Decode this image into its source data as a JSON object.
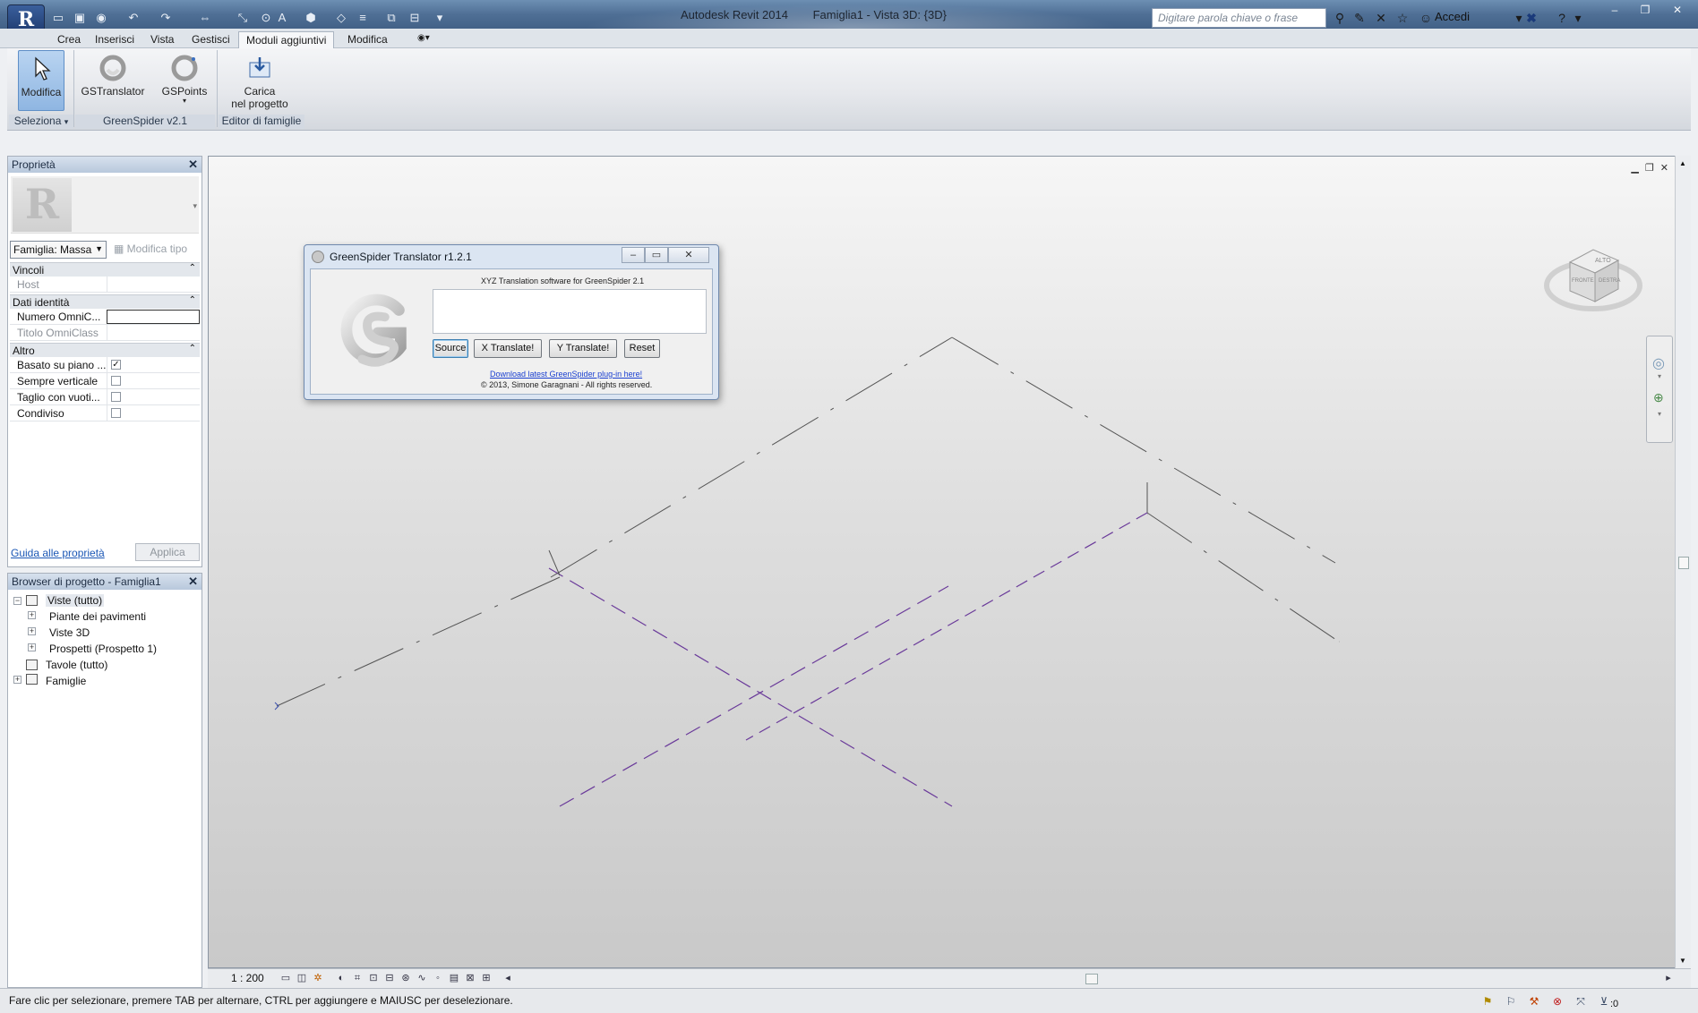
{
  "window": {
    "app_name": "Autodesk Revit 2014",
    "document_title": "Famiglia1 - Vista 3D: {3D}",
    "search_placeholder": "Digitare parola chiave o frase",
    "sign_in": "Accedi"
  },
  "tabs": [
    "Crea",
    "Inserisci",
    "Vista",
    "Gestisci",
    "Moduli aggiuntivi",
    "Modifica"
  ],
  "active_tab": "Moduli aggiuntivi",
  "ribbon": {
    "modify_label": "Modifica",
    "gstranslator_label": "GSTranslator",
    "gspoints_label": "GSPoints",
    "carica_line1": "Carica",
    "carica_line2": "nel progetto",
    "panels": {
      "seleziona": "Seleziona",
      "greenspider": "GreenSpider v2.1",
      "editor": "Editor di famiglie"
    }
  },
  "properties": {
    "title": "Proprietà",
    "family": "Famiglia: Massa",
    "edit_type": "Modifica tipo",
    "groups": {
      "vincoli": "Vincoli",
      "dati_identita": "Dati identità",
      "altro": "Altro"
    },
    "rows": {
      "host": "Host",
      "numero_omni": "Numero OmniC...",
      "titolo_omni": "Titolo OmniClass",
      "basato": "Basato su piano ...",
      "sempre": "Sempre verticale",
      "taglio": "Taglio con vuoti...",
      "condiviso": "Condiviso"
    },
    "checks": {
      "basato": true,
      "sempre": false,
      "taglio": false,
      "condiviso": false
    },
    "help_link": "Guida alle proprietà",
    "apply": "Applica"
  },
  "browser": {
    "title": "Browser di progetto - Famiglia1",
    "items": {
      "viste": "Viste (tutto)",
      "piante": "Piante dei pavimenti",
      "viste3d": "Viste 3D",
      "prospetti": "Prospetti (Prospetto 1)",
      "tavole": "Tavole (tutto)",
      "famiglie": "Famiglie"
    }
  },
  "dialog": {
    "title": "GreenSpider Translator r1.2.1",
    "subtitle": "XYZ Translation software for GreenSpider 2.1",
    "text_value": "",
    "buttons": {
      "source": "Source",
      "x": "X Translate!",
      "y": "Y Translate!",
      "reset": "Reset"
    },
    "link": "Download latest GreenSpider plug-in here!",
    "copyright": "© 2013, Simone Garagnani - All rights reserved."
  },
  "viewcube": {
    "top": "ALTO",
    "front": "FRONTE",
    "right": "DESTRA"
  },
  "view_bar": {
    "scale": "1 : 200"
  },
  "status_bar": {
    "text": "Fare clic per selezionare, premere TAB per alternare, CTRL per aggiungere e MAIUSC per deselezionare.",
    "filter_count": ":0"
  },
  "colors": {
    "title_bar": "#4f6f95",
    "accent": "#1b57b5",
    "ref_lines": "#6a3a9a"
  }
}
